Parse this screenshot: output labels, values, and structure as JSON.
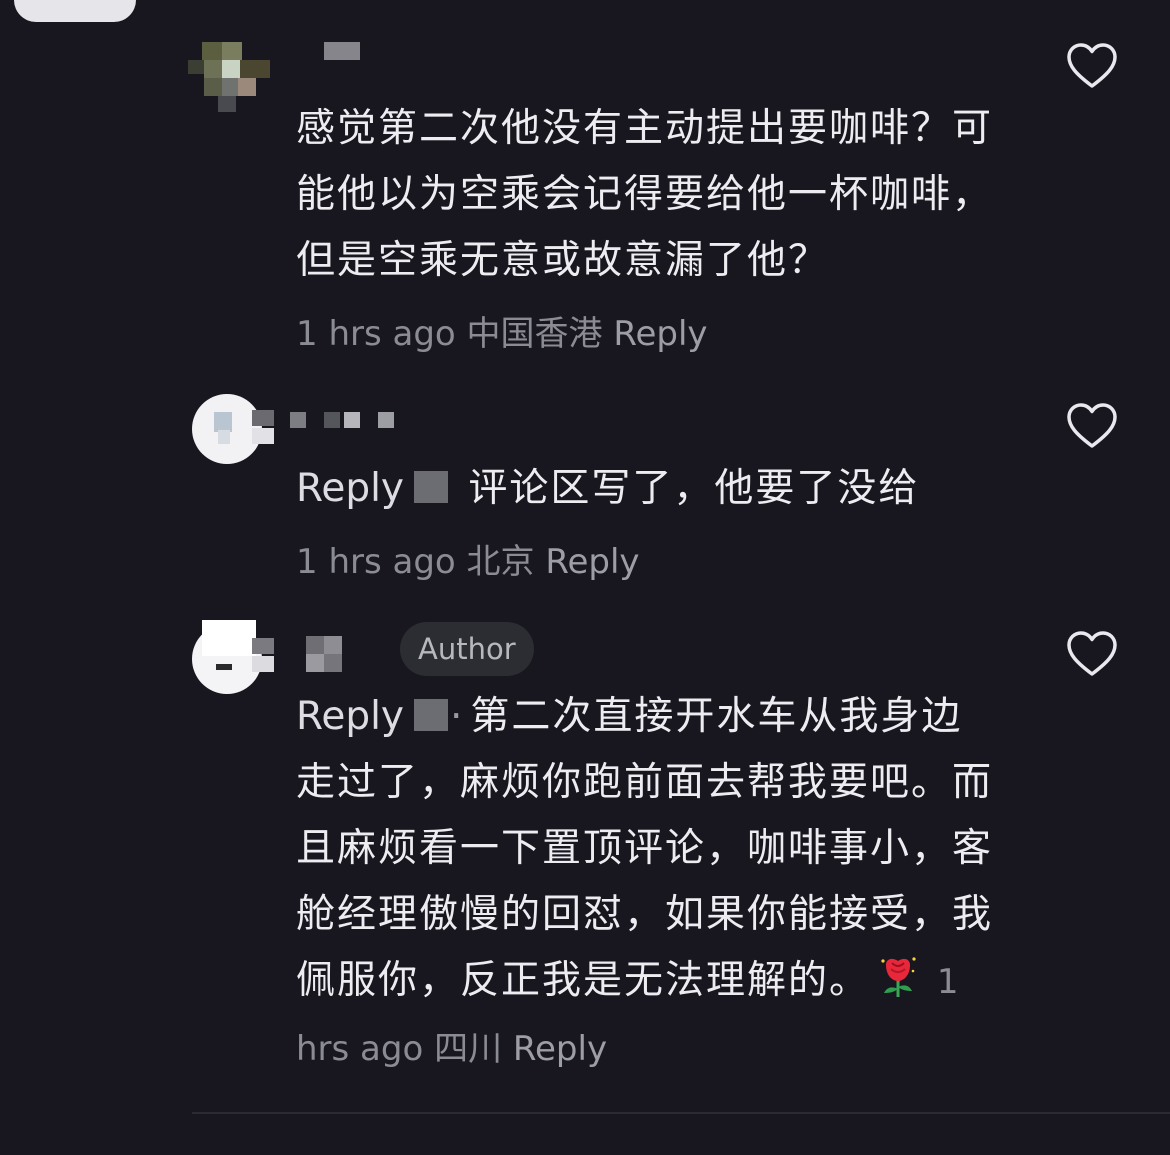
{
  "comments": [
    {
      "body": "感觉第二次他没有主动提出要咖啡？可能他以为空乘会记得要给他一杯咖啡，但是空乘无意或故意漏了他？",
      "time": "1 hrs ago",
      "location": "中国香港",
      "reply_label": "Reply"
    },
    {
      "reply_prefix": "Reply",
      "body": "评论区写了，他要了没给",
      "time": "1 hrs ago",
      "location": "北京",
      "reply_label": "Reply"
    },
    {
      "badge": "Author",
      "reply_prefix": "Reply",
      "separator": "·",
      "body": "第二次直接开水车从我身边走过了，麻烦你跑前面去帮我要吧。而且麻烦看一下置顶评论，咖啡事小，客舱经理傲慢的回怼，如果你能接受，我佩服你，反正我是无法理解的。",
      "emoji_icon": "rose-icon",
      "time": "1 hrs ago",
      "location": "四川",
      "reply_label": "Reply"
    }
  ],
  "icons": {
    "like": "heart-outline-icon"
  },
  "colors": {
    "background": "#18171f",
    "text": "#ececf1",
    "muted": "#8b8b94"
  }
}
